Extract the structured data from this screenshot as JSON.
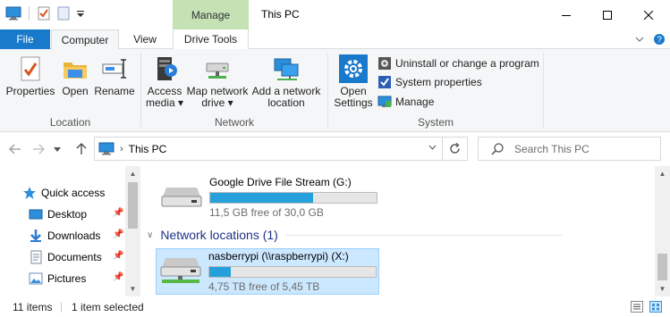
{
  "window": {
    "title": "This PC",
    "context_tab_header": "Manage"
  },
  "tabs": {
    "file": "File",
    "computer": "Computer",
    "view": "View",
    "drive_tools": "Drive Tools"
  },
  "ribbon": {
    "location": {
      "label": "Location",
      "properties": "Properties",
      "open": "Open",
      "rename": "Rename"
    },
    "network": {
      "label": "Network",
      "access_media": [
        "Access",
        "media ▾"
      ],
      "map_network_drive": [
        "Map network",
        "drive ▾"
      ],
      "add_network_location": [
        "Add a network",
        "location"
      ]
    },
    "system": {
      "label": "System",
      "open_settings": [
        "Open",
        "Settings"
      ],
      "uninstall": "Uninstall or change a program",
      "system_properties": "System properties",
      "manage": "Manage"
    }
  },
  "address": {
    "path": "This PC",
    "search_placeholder": "Search This PC"
  },
  "nav_pane": {
    "items": [
      {
        "label": "Quick access",
        "icon": "star-icon"
      },
      {
        "label": "Desktop",
        "icon": "desktop-icon",
        "pinned": true
      },
      {
        "label": "Downloads",
        "icon": "download-icon",
        "pinned": true
      },
      {
        "label": "Documents",
        "icon": "documents-icon",
        "pinned": true
      },
      {
        "label": "Pictures",
        "icon": "pictures-icon",
        "pinned": true
      }
    ]
  },
  "main": {
    "drives": [
      {
        "name": "Google Drive File Stream (G:)",
        "free": "11,5 GB free of 30,0 GB",
        "used_fraction": 0.617
      }
    ],
    "network_section": {
      "header": "Network locations (1)",
      "items": [
        {
          "name": "nasberrypi (\\\\raspberrypi) (X:)",
          "free": "4,75 TB free of 5,45 TB",
          "used_fraction": 0.128
        }
      ]
    }
  },
  "status": {
    "items_count": "11 items",
    "selected": "1 item selected"
  },
  "colors": {
    "accent": "#1979ca",
    "context_tab": "#c4e2b4",
    "selection": "#cce8ff",
    "bar_fill": "#26a0da",
    "section_header": "#1e3287"
  }
}
